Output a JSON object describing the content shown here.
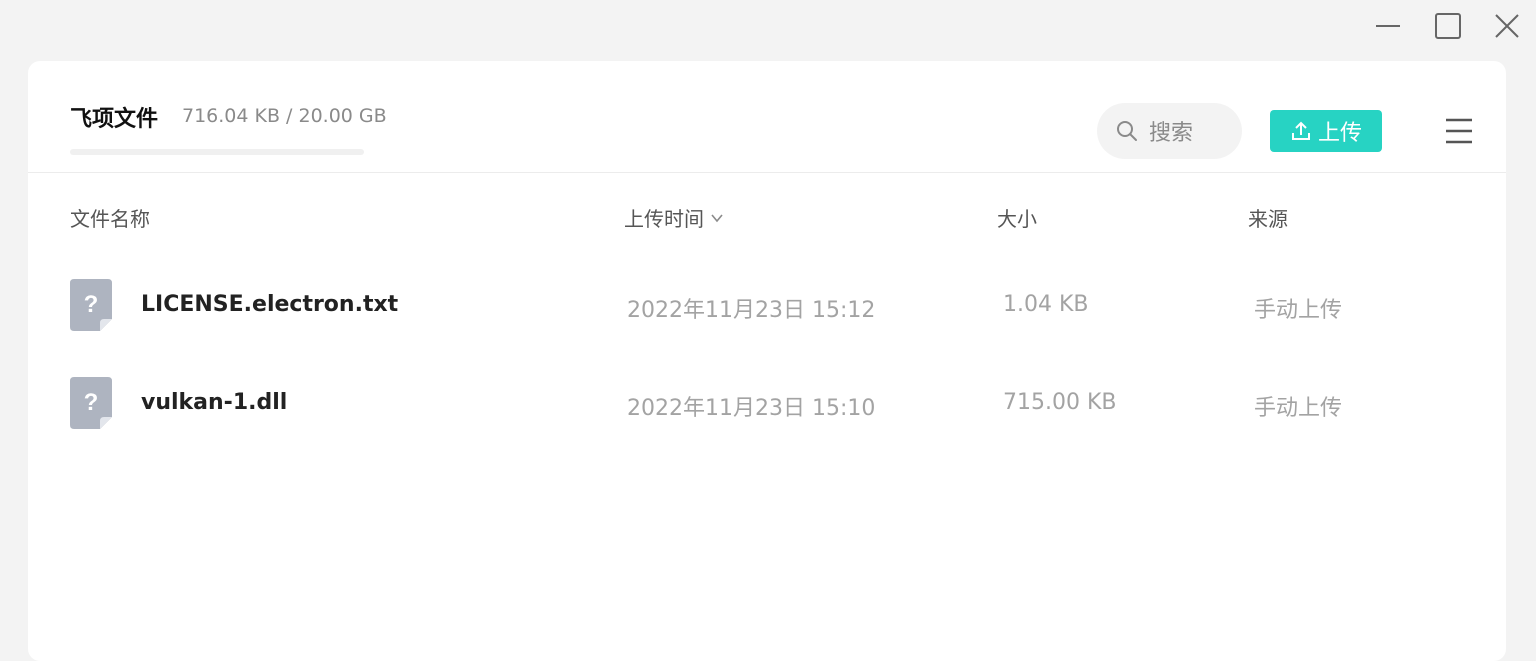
{
  "window": {
    "controls": [
      "minimize-icon",
      "maximize-icon",
      "close-icon"
    ]
  },
  "header": {
    "app_title": "飞项文件",
    "storage_text": "716.04 KB / 20.00 GB",
    "storage_used_fraction": 3e-05,
    "search_placeholder": "搜索",
    "upload_label": "上传",
    "accent_color": "#27d3c3"
  },
  "table": {
    "columns": {
      "name": "文件名称",
      "time": "上传时间",
      "size": "大小",
      "source": "来源"
    },
    "rows": [
      {
        "name": "LICENSE.electron.txt",
        "time": "2022年11月23日 15:12",
        "size": "1.04 KB",
        "source": "手动上传",
        "icon": "unknown-file-icon"
      },
      {
        "name": "vulkan-1.dll",
        "time": "2022年11月23日 15:10",
        "size": "715.00 KB",
        "source": "手动上传",
        "icon": "unknown-file-icon"
      }
    ]
  }
}
